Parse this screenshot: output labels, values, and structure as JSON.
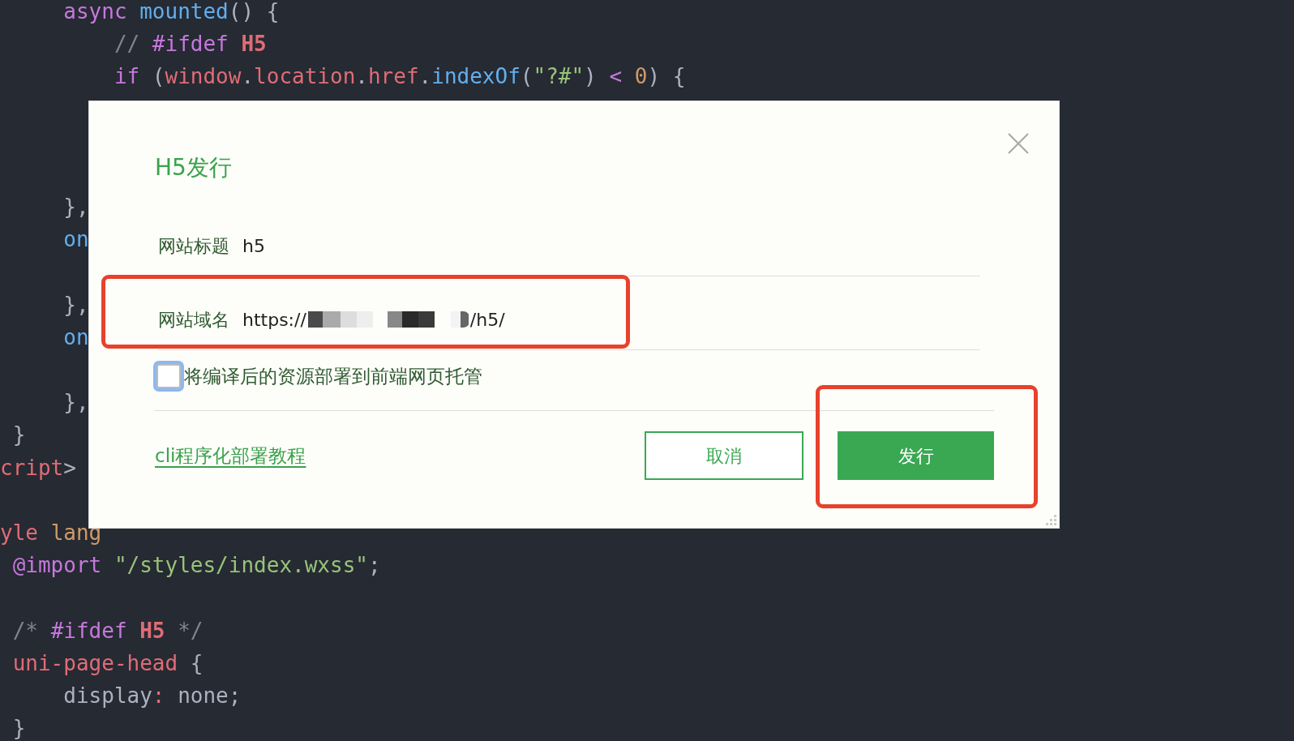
{
  "editor": {
    "lines": [
      {
        "kind": "code",
        "tokens": [
          {
            "kind": "keyword",
            "text": "     async "
          },
          {
            "kind": "function",
            "text": "mounted"
          },
          {
            "kind": "punct",
            "text": "() {"
          }
        ]
      },
      {
        "kind": "code",
        "tokens": [
          {
            "kind": "comment",
            "text": "         // "
          },
          {
            "kind": "keyword",
            "text": "#ifdef "
          },
          {
            "kind": "macro",
            "text": "H5"
          }
        ]
      },
      {
        "kind": "code",
        "tokens": [
          {
            "kind": "keyword",
            "text": "         if"
          },
          {
            "kind": "punct",
            "text": " ("
          },
          {
            "kind": "variable",
            "text": "window"
          },
          {
            "kind": "punct",
            "text": "."
          },
          {
            "kind": "variable",
            "text": "location"
          },
          {
            "kind": "punct",
            "text": "."
          },
          {
            "kind": "variable",
            "text": "href"
          },
          {
            "kind": "punct",
            "text": "."
          },
          {
            "kind": "function",
            "text": "indexOf"
          },
          {
            "kind": "punct",
            "text": "("
          },
          {
            "kind": "string",
            "text": "\"?#\""
          },
          {
            "kind": "punct",
            "text": ") "
          },
          {
            "kind": "keyword",
            "text": "< "
          },
          {
            "kind": "number",
            "text": "0"
          },
          {
            "kind": "punct",
            "text": ") {"
          }
        ]
      },
      {
        "kind": "blank"
      },
      {
        "kind": "blank"
      },
      {
        "kind": "blank"
      },
      {
        "kind": "code",
        "tokens": [
          {
            "kind": "punct",
            "text": "     },"
          }
        ]
      },
      {
        "kind": "code",
        "tokens": [
          {
            "kind": "function",
            "text": "     on"
          }
        ]
      },
      {
        "kind": "blank"
      },
      {
        "kind": "code",
        "tokens": [
          {
            "kind": "punct",
            "text": "     },"
          }
        ]
      },
      {
        "kind": "code",
        "tokens": [
          {
            "kind": "function",
            "text": "     on"
          }
        ]
      },
      {
        "kind": "blank"
      },
      {
        "kind": "code",
        "tokens": [
          {
            "kind": "punct",
            "text": "     },"
          }
        ]
      },
      {
        "kind": "code",
        "tokens": [
          {
            "kind": "punct",
            "text": " }"
          }
        ]
      },
      {
        "kind": "code",
        "tokens": [
          {
            "kind": "variable",
            "text": "cript"
          },
          {
            "kind": "punct",
            "text": ">"
          }
        ]
      },
      {
        "kind": "blank"
      },
      {
        "kind": "code",
        "tokens": [
          {
            "kind": "variable",
            "text": "yle "
          },
          {
            "kind": "number",
            "text": "lang"
          }
        ]
      },
      {
        "kind": "code",
        "tokens": [
          {
            "kind": "keyword",
            "text": " @import "
          },
          {
            "kind": "string",
            "text": "\"/styles/index.wxss\""
          },
          {
            "kind": "punct",
            "text": ";"
          }
        ]
      },
      {
        "kind": "blank"
      },
      {
        "kind": "code",
        "tokens": [
          {
            "kind": "comment",
            "text": " /* "
          },
          {
            "kind": "keyword",
            "text": "#ifdef "
          },
          {
            "kind": "macro",
            "text": "H5"
          },
          {
            "kind": "comment",
            "text": " */"
          }
        ]
      },
      {
        "kind": "code",
        "tokens": [
          {
            "kind": "variable",
            "text": " uni-page-head"
          },
          {
            "kind": "punct",
            "text": " {"
          }
        ]
      },
      {
        "kind": "code",
        "tokens": [
          {
            "kind": "punct",
            "text": "     display"
          },
          {
            "kind": "variable",
            "text": ":"
          },
          {
            "kind": "punct",
            "text": " none;"
          }
        ]
      },
      {
        "kind": "code",
        "tokens": [
          {
            "kind": "punct",
            "text": " }"
          }
        ]
      }
    ]
  },
  "dialog": {
    "title": "H5发行",
    "fields": [
      {
        "label": "网站标题",
        "value": "h5"
      },
      {
        "label": "网站域名",
        "value_prefix": "https://",
        "value_suffix": "/h5/",
        "redacted": true
      }
    ],
    "checkbox": {
      "label": "将编译后的资源部署到前端网页托管",
      "checked": false,
      "focused": true
    },
    "link": "cli程序化部署教程",
    "buttons": [
      {
        "label": "取消",
        "kind": "secondary"
      },
      {
        "label": "发行",
        "kind": "primary"
      }
    ]
  }
}
